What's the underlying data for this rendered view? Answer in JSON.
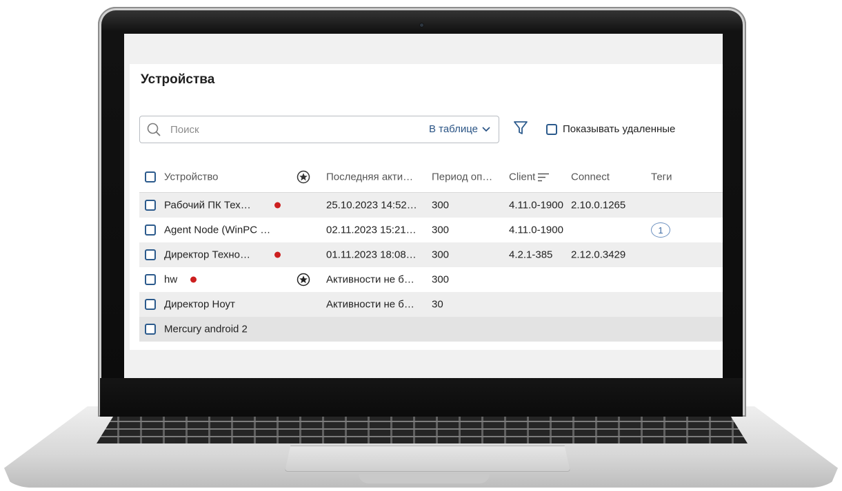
{
  "page": {
    "title": "Устройства",
    "search": {
      "placeholder": "Поиск",
      "scope": "В таблице"
    },
    "show_deleted_label": "Показывать удаленные"
  },
  "table": {
    "columns": {
      "device": "Устройство",
      "last_activity": "Последняя акти…",
      "period": "Период оп…",
      "client": "Client",
      "connect": "Connect",
      "tags": "Теги"
    },
    "rows": [
      {
        "device": "Рабочий ПК Тех…",
        "status_dot": true,
        "starred": false,
        "last_activity": "25.10.2023 14:52…",
        "period": "300",
        "client": "4.11.0-1900",
        "connect": "2.10.0.1265",
        "tags": ""
      },
      {
        "device": "Agent Node (WinPC …",
        "status_dot": false,
        "starred": false,
        "last_activity": "02.11.2023 15:21…",
        "period": "300",
        "client": "4.11.0-1900",
        "connect": "",
        "tags": "1"
      },
      {
        "device": "Директор Техно…",
        "status_dot": true,
        "starred": false,
        "last_activity": "01.11.2023 18:08…",
        "period": "300",
        "client": "4.2.1-385",
        "connect": "2.12.0.3429",
        "tags": ""
      },
      {
        "device": "hw",
        "status_dot": true,
        "starred": true,
        "last_activity": "Активности не б…",
        "period": "300",
        "client": "",
        "connect": "",
        "tags": ""
      },
      {
        "device": "Директор Ноут",
        "status_dot": false,
        "starred": false,
        "last_activity": "Активности не б…",
        "period": "30",
        "client": "",
        "connect": "",
        "tags": ""
      },
      {
        "device": "Mercury android 2",
        "status_dot": false,
        "starred": false,
        "last_activity": "",
        "period": "",
        "client": "",
        "connect": "",
        "tags": ""
      }
    ]
  },
  "colors": {
    "accent": "#2b5a8c",
    "status_dot": "#cc1f1f"
  }
}
